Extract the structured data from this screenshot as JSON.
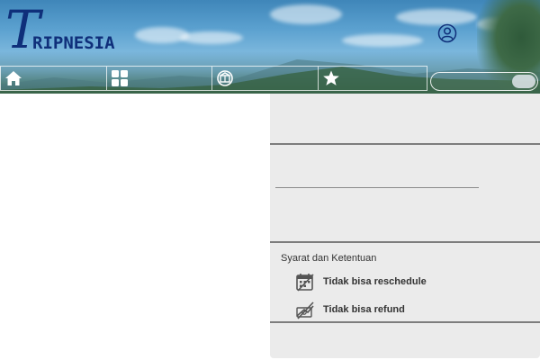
{
  "brand": {
    "logo_initial": "T",
    "logo_text": "RIPNESIA"
  },
  "header": {
    "user_icon": "user-circle-icon"
  },
  "nav": {
    "items": [
      {
        "icon": "home-icon"
      },
      {
        "icon": "grid-icon"
      },
      {
        "icon": "package-icon"
      },
      {
        "icon": "star-icon"
      }
    ]
  },
  "search": {
    "placeholder": ""
  },
  "terms": {
    "title": "Syarat dan Ketentuan",
    "items": [
      {
        "icon": "calendar-no-reschedule-icon",
        "label": "Tidak bisa reschedule"
      },
      {
        "icon": "no-refund-icon",
        "label": "Tidak bisa refund"
      }
    ]
  },
  "colors": {
    "brand": "#0f2f7a",
    "panel_bg": "#ebebeb",
    "divider": "#7d7d7d"
  }
}
